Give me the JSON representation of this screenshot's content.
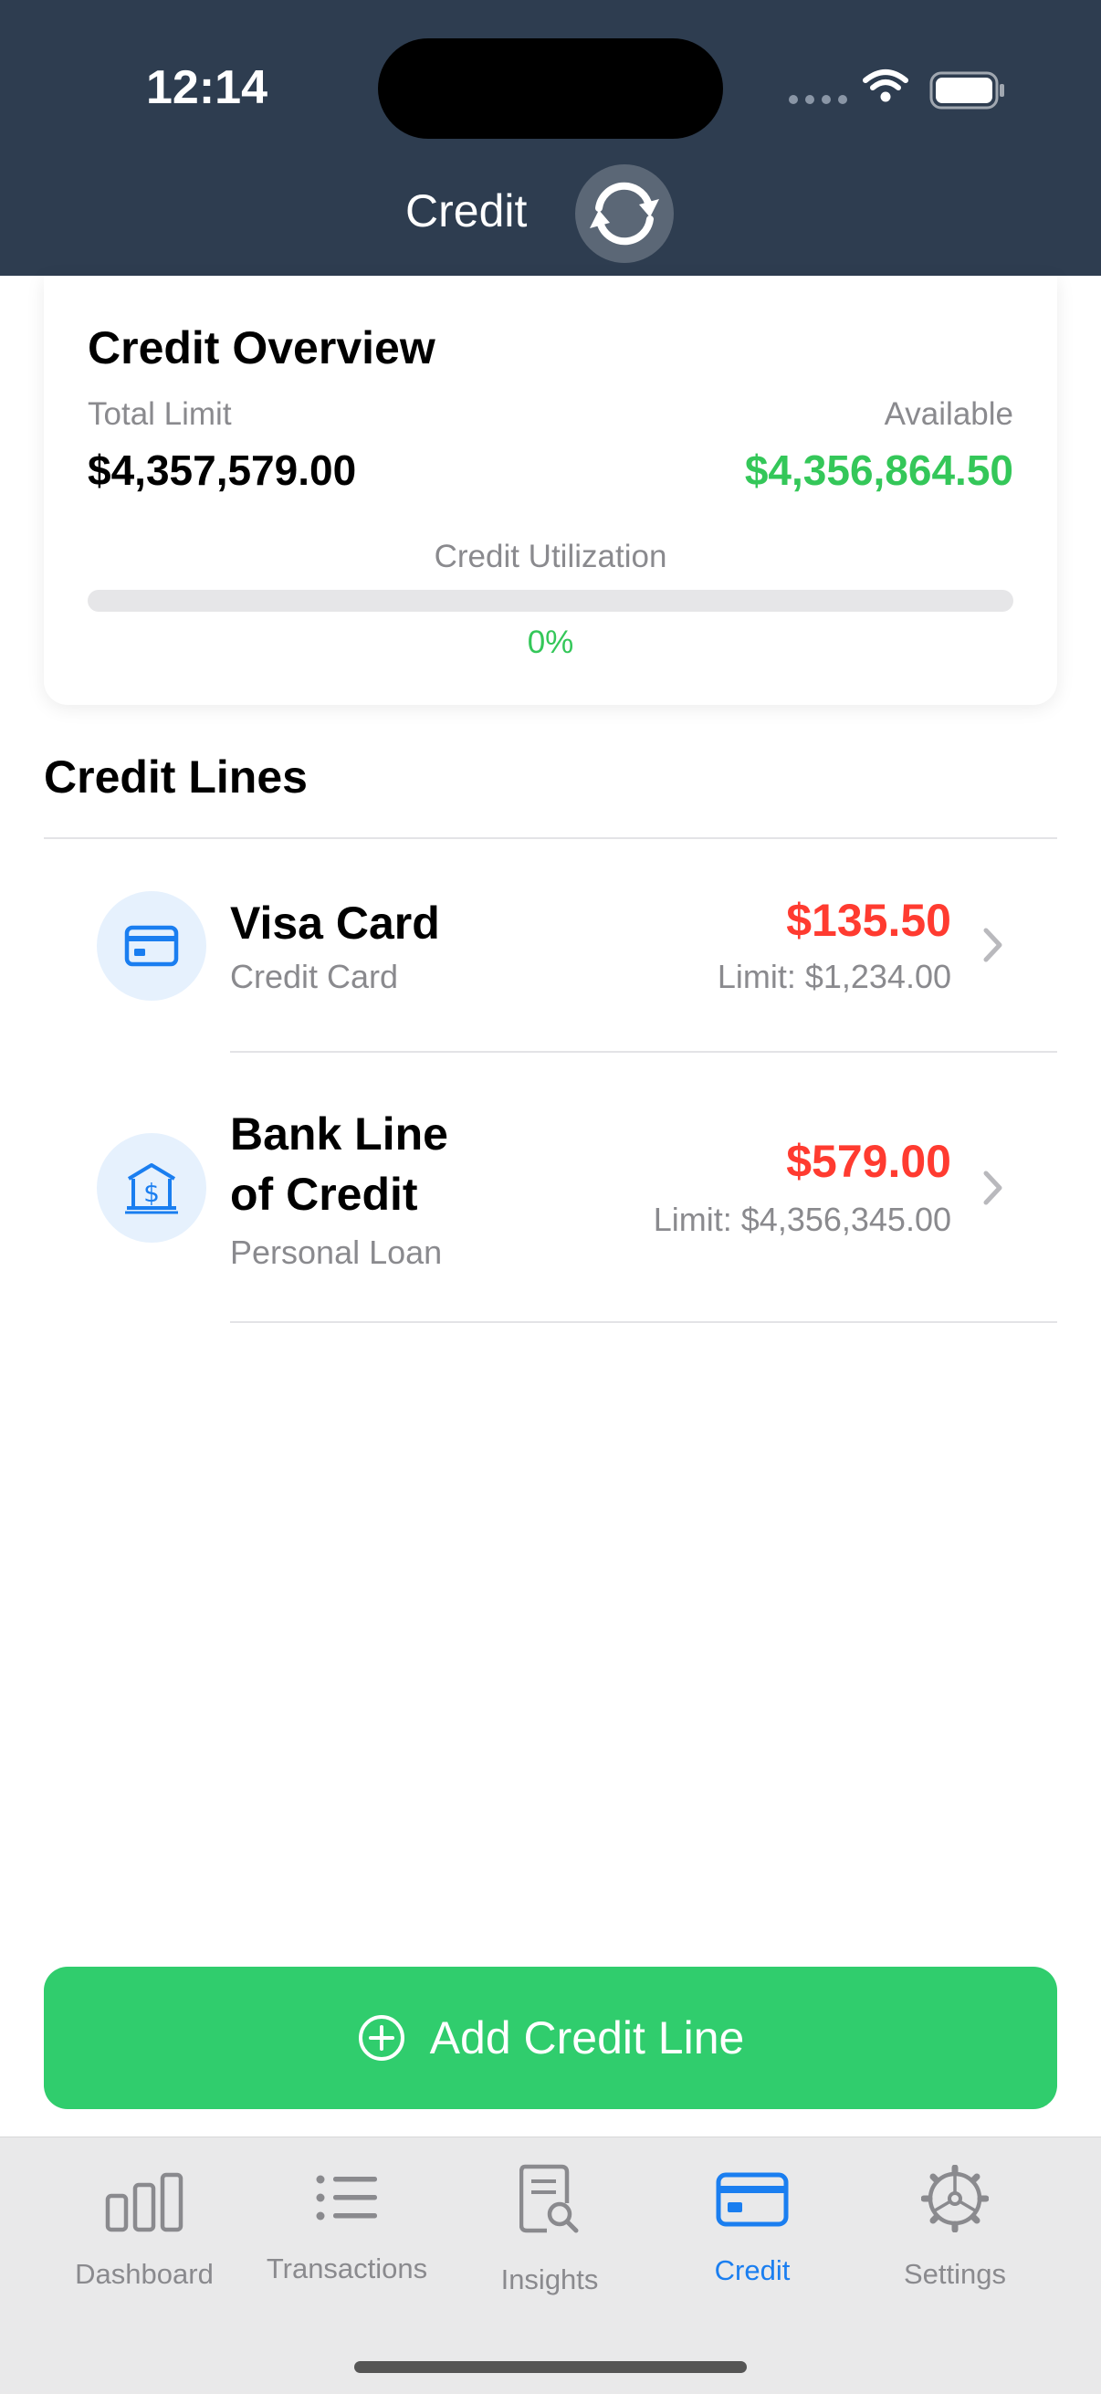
{
  "status_bar": {
    "time": "12:14"
  },
  "nav": {
    "title": "Credit",
    "refresh_icon": "refresh-icon"
  },
  "overview": {
    "title": "Credit Overview",
    "total_limit_label": "Total Limit",
    "total_limit_value": "$4,357,579.00",
    "available_label": "Available",
    "available_value": "$4,356,864.50",
    "utilization_label": "Credit Utilization",
    "utilization_value": "0%",
    "utilization_fraction": 0.0,
    "available_color": "#34c759"
  },
  "credit_lines": {
    "title": "Credit Lines",
    "items": [
      {
        "name": "Visa Card",
        "type": "Credit Card",
        "balance": "$135.50",
        "limit": "Limit: $1,234.00",
        "icon": "credit-card-icon"
      },
      {
        "name_line1": "Bank Line",
        "name_line2": "of Credit",
        "type": "Personal Loan",
        "balance": "$579.00",
        "limit": "Limit: $4,356,345.00",
        "icon": "bank-icon"
      }
    ],
    "balance_color": "#ff3b30"
  },
  "add_button": {
    "label": "Add Credit Line",
    "icon": "plus-circle-icon",
    "color": "#30cd6d"
  },
  "tabbar": {
    "tabs": [
      {
        "label": "Dashboard",
        "icon": "bar-chart-icon",
        "active": false
      },
      {
        "label": "Transactions",
        "icon": "list-icon",
        "active": false
      },
      {
        "label": "Insights",
        "icon": "document-search-icon",
        "active": false
      },
      {
        "label": "Credit",
        "icon": "credit-card-icon",
        "active": true
      },
      {
        "label": "Settings",
        "icon": "gear-icon",
        "active": false
      }
    ],
    "active_color": "#1a7ef0"
  }
}
